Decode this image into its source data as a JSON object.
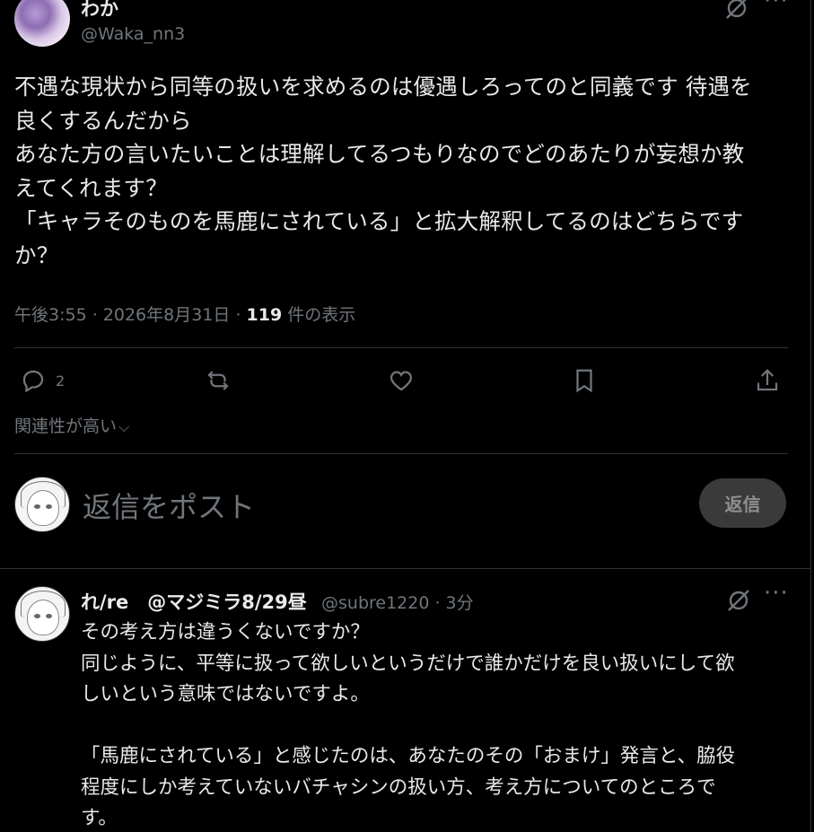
{
  "tweet": {
    "display_name": "わか",
    "handle": "@Waka_nn3",
    "lines": [
      "不遇な現状から同等の扱いを求めるのは優遇しろってのと同義です 待遇を",
      "良くするんだから",
      "あなた方の言いたいことは理解してるつもりなのでどのあたりが妄想か教",
      "えてくれます？",
      "「キャラそのものを馬鹿にされている」と拡大解釈してるのはどちらです",
      "か？"
    ],
    "timestamp": "午後3:55 · 2026年8月31日 · ",
    "views_count": "119",
    "views_label": " 件の表示"
  },
  "actions": {
    "reply_count": "2",
    "retweet_icon": "retweet-icon",
    "like_icon": "heart-icon",
    "bookmark_icon": "bookmark-icon",
    "share_icon": "share-icon"
  },
  "sort": {
    "label": "関連性が高い",
    "chevron": "⌵"
  },
  "reply_composer": {
    "placeholder": "返信をポスト",
    "button_label": "返信"
  },
  "reply": {
    "display_name": "れ/re　@マジミラ8/29昼",
    "handle_time": "@subre1220 · 3分",
    "lines": [
      "その考え方は違うくないですか？",
      "同じように、平等に扱って欲しいというだけで誰かだけを良い扱いにして欲",
      "しいという意味ではないですよ。",
      "",
      "「馬鹿にされている」と感じたのは、あなたのその「おまけ」発言と、脇役",
      "程度にしか考えていないバチャシンの扱い方、考え方についてのところで",
      "す。"
    ]
  }
}
